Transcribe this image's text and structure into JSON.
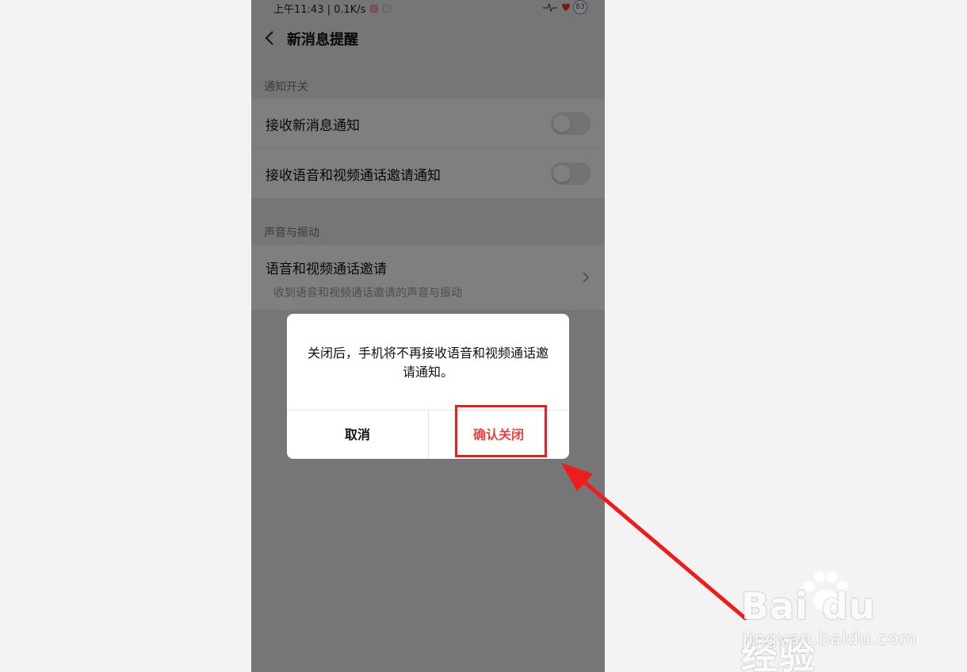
{
  "status_bar": {
    "time_speed": "上午11:43 | 0.1K/s",
    "battery": "83"
  },
  "header": {
    "title": "新消息提醒"
  },
  "sections": {
    "notify_switch_label": "通知开关",
    "notify_rows": [
      {
        "label": "接收新消息通知",
        "enabled": false
      },
      {
        "label": "接收语音和视频通话邀请通知",
        "enabled": false
      }
    ],
    "sound_label": "声音与振动",
    "sound_row": {
      "title": "语音和视频通话邀请",
      "subtitle": "收到语音和视频通话邀请的声音与振动"
    }
  },
  "dialog": {
    "message": "关闭后，手机将不再接收语音和视频通话邀请通知。",
    "cancel_label": "取消",
    "confirm_label": "确认关闭"
  },
  "watermark": {
    "logo_text": "Bai du 经验",
    "url": "jingyan.baidu.com"
  },
  "colors": {
    "accent_red": "#e64340",
    "annotation_red": "#ee1c1c"
  },
  "icons": {
    "back": "chevron-left-icon",
    "chevron": "chevron-right-icon",
    "arrow": "annotation-arrow-icon"
  }
}
